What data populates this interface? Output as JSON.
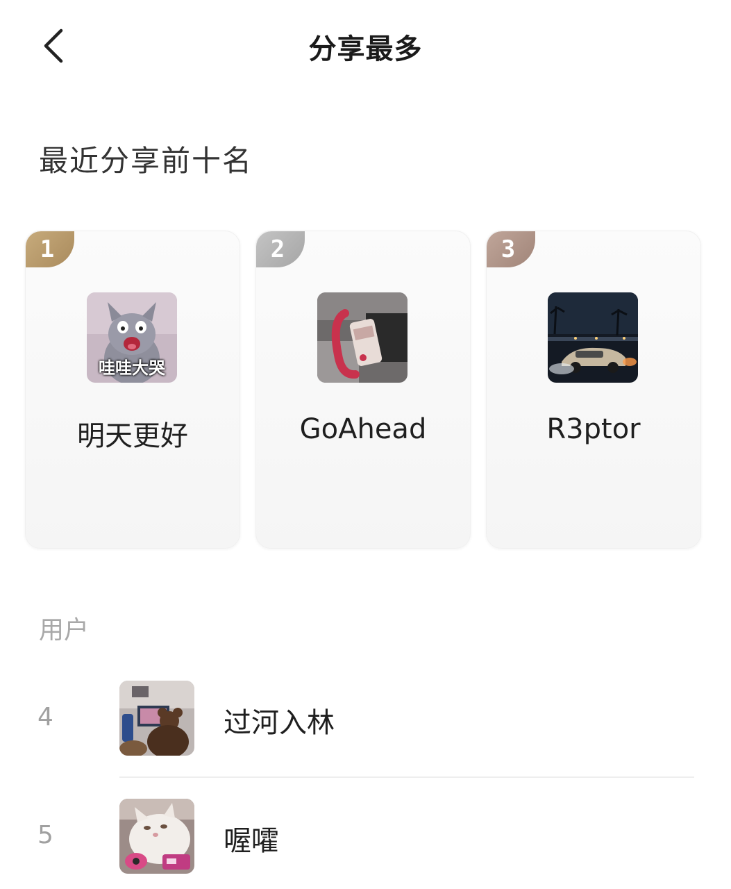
{
  "header": {
    "title": "分享最多",
    "back_icon": "chevron-left-icon"
  },
  "section_title": "最近分享前十名",
  "podium": [
    {
      "rank": "1",
      "name": "明天更好",
      "badge_color": "#b89b6e",
      "avatar_caption": "哇哇大哭",
      "avatar_icon": "cartoon-cat-crying"
    },
    {
      "rank": "2",
      "name": "GoAhead",
      "badge_color": "#b8b8b8",
      "avatar_icon": "red-phone-photo"
    },
    {
      "rank": "3",
      "name": "R3ptor",
      "badge_color": "#b39b90",
      "avatar_icon": "night-car-photo"
    }
  ],
  "list": {
    "header": "用户",
    "rows": [
      {
        "rank": "4",
        "name": "过河入林",
        "avatar_icon": "teddy-bear-photo"
      },
      {
        "rank": "5",
        "name": "喔嚯",
        "avatar_icon": "white-cat-photo"
      }
    ]
  },
  "colors": {
    "gold": "#b89b6e",
    "silver": "#b8b8b8",
    "bronze": "#b39b90",
    "muted_text": "#a8a8a8"
  }
}
